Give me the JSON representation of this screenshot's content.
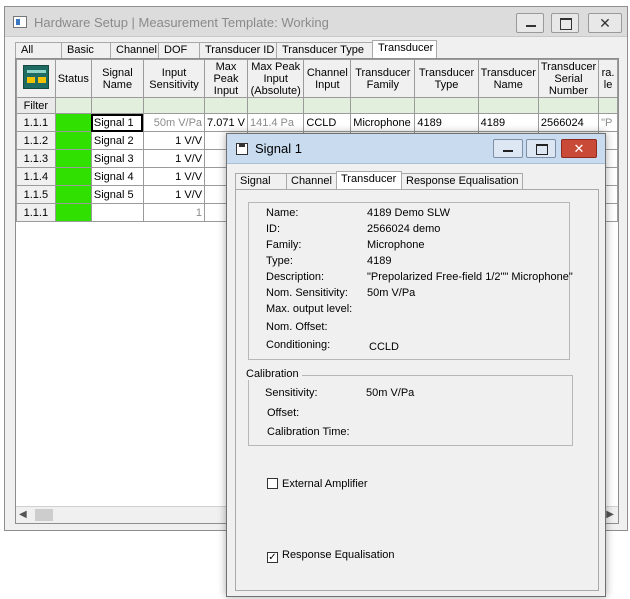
{
  "main_window": {
    "title": "Hardware Setup | Measurement Template: Working",
    "tabs": [
      "All",
      "Basic",
      "Channel",
      "DOF",
      "Transducer ID",
      "Transducer Type",
      "Transducer"
    ],
    "active_tab": "Transducer",
    "columns": [
      "Status",
      "Signal Name",
      "Input Sensitivity",
      "Max Peak Input",
      "Max Peak Input (Absolute)",
      "Channel Input",
      "Transducer Family",
      "Transducer Type",
      "Transducer Name",
      "Transducer Serial Number",
      "ra. le"
    ],
    "filter_label": "Filter",
    "rows": [
      {
        "id": "1.1.1",
        "name": "Signal 1",
        "sensitivity": "50m V/Pa",
        "max_peak": "7.071 V",
        "max_peak_abs": "141.4 Pa",
        "channel_input": "CCLD",
        "family": "Microphone",
        "type": "4189",
        "tname": "4189",
        "serial": "2566024",
        "extra": "\"P"
      },
      {
        "id": "1.1.2",
        "name": "Signal 2",
        "sensitivity": "1 V/V",
        "max_peak": "",
        "max_peak_abs": "",
        "channel_input": "",
        "family": "",
        "type": "",
        "tname": "",
        "serial": "",
        "extra": ""
      },
      {
        "id": "1.1.3",
        "name": "Signal 3",
        "sensitivity": "1 V/V",
        "max_peak": "",
        "max_peak_abs": "",
        "channel_input": "",
        "family": "",
        "type": "",
        "tname": "",
        "serial": "",
        "extra": ""
      },
      {
        "id": "1.1.4",
        "name": "Signal 4",
        "sensitivity": "1 V/V",
        "max_peak": "",
        "max_peak_abs": "",
        "channel_input": "",
        "family": "",
        "type": "",
        "tname": "",
        "serial": "",
        "extra": ""
      },
      {
        "id": "1.1.5",
        "name": "Signal 5",
        "sensitivity": "1 V/V",
        "max_peak": "",
        "max_peak_abs": "",
        "channel_input": "",
        "family": "",
        "type": "",
        "tname": "",
        "serial": "",
        "extra": ""
      }
    ],
    "partial_row": {
      "id": "1.1.1",
      "sensitivity": "1"
    },
    "status_color": "#2fe000"
  },
  "dialog": {
    "title": "Signal 1",
    "tabs": [
      "Signal",
      "Channel",
      "Transducer",
      "Response Equalisation"
    ],
    "active_tab": "Transducer",
    "info": {
      "name_label": "Name:",
      "name_value": "4189 Demo SLW",
      "id_label": "ID:",
      "id_value": "2566024 demo",
      "family_label": "Family:",
      "family_value": "Microphone",
      "type_label": "Type:",
      "type_value": "4189",
      "description_label": "Description:",
      "description_value": "\"Prepolarized Free-field 1/2\"\" Microphone\"",
      "nom_sensitivity_label": "Nom. Sensitivity:",
      "nom_sensitivity_value": "50m V/Pa",
      "max_output_label": "Max. output level:",
      "nom_offset_label": "Nom. Offset:",
      "conditioning_label": "Conditioning:",
      "conditioning_value": "CCLD"
    },
    "calibration": {
      "legend": "Calibration",
      "sensitivity_label": "Sensitivity:",
      "sensitivity_value": "50m V/Pa",
      "offset_label": "Offset:",
      "calibration_time_label": "Calibration Time:"
    },
    "external_amplifier": {
      "label": "External Amplifier",
      "checked": false
    },
    "response_equalisation": {
      "label": "Response Equalisation",
      "checked": true
    }
  }
}
